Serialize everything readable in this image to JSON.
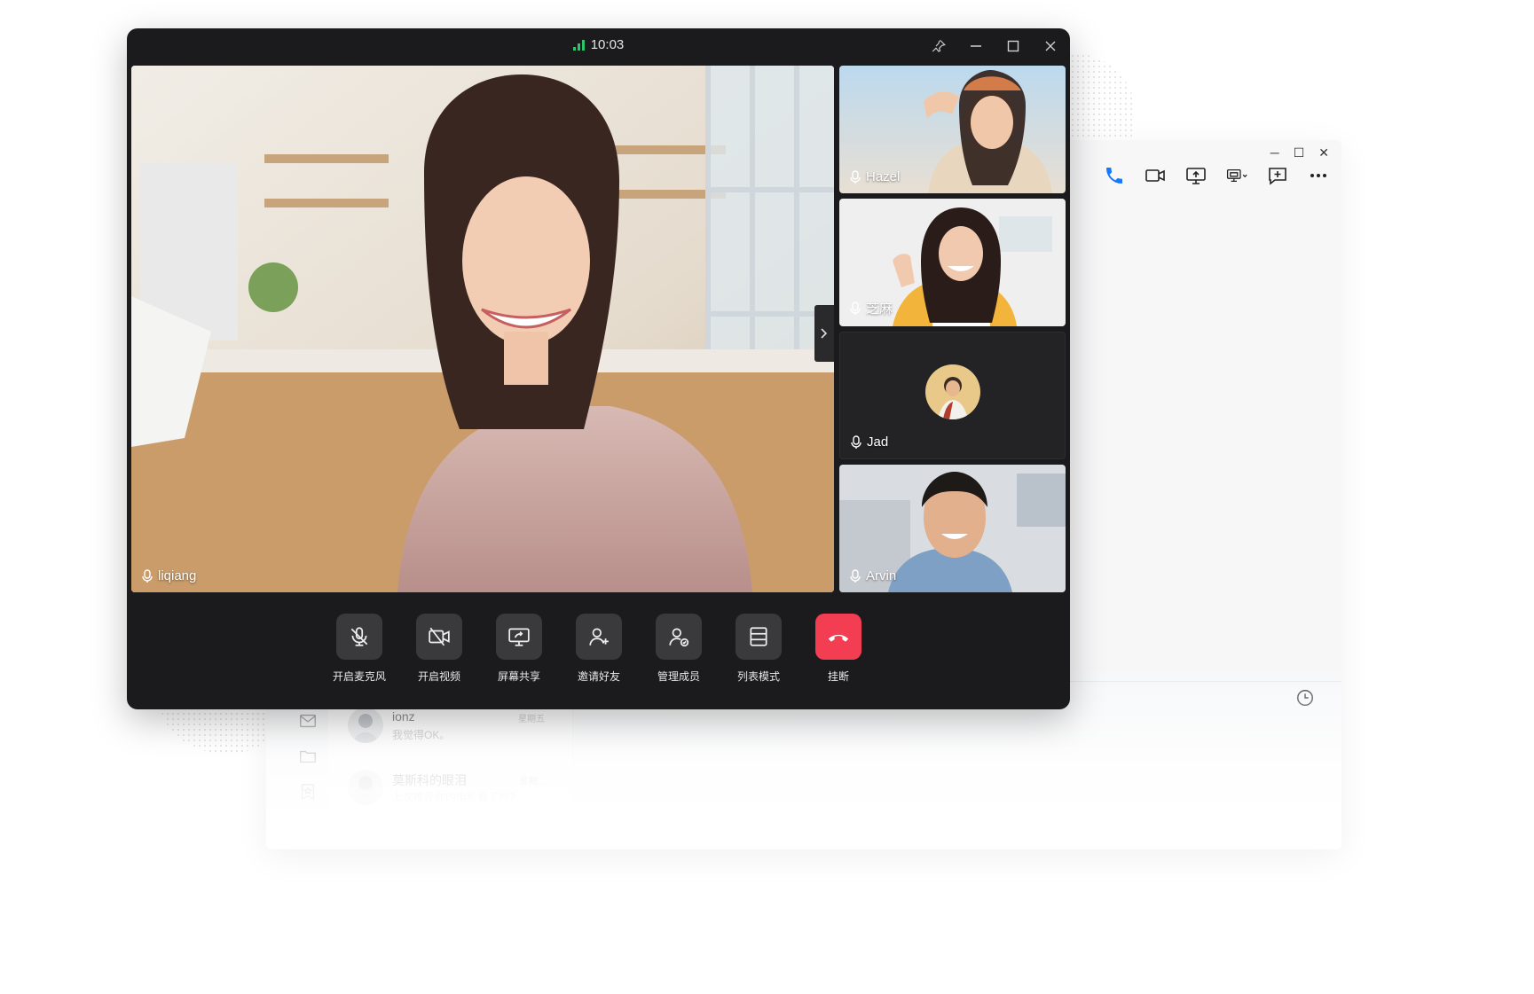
{
  "call_window": {
    "time": "10:03",
    "main_participant": {
      "name": "liqiang"
    },
    "participants": [
      {
        "name": "Hazel"
      },
      {
        "name": "芝麻"
      },
      {
        "name": "Jad"
      },
      {
        "name": "Arvin"
      }
    ],
    "controls": [
      {
        "label": "开启麦克风",
        "icon": "mic-off-icon"
      },
      {
        "label": "开启视频",
        "icon": "video-off-icon"
      },
      {
        "label": "屏幕共享",
        "icon": "screen-share-icon"
      },
      {
        "label": "邀请好友",
        "icon": "add-user-icon"
      },
      {
        "label": "管理成员",
        "icon": "manage-members-icon"
      },
      {
        "label": "列表模式",
        "icon": "list-mode-icon"
      },
      {
        "label": "挂断",
        "icon": "hang-up-icon"
      }
    ],
    "colors": {
      "hangup": "#f23d53",
      "signal": "#2bc56b",
      "background": "#1b1b1d"
    }
  },
  "chat_window": {
    "conversations": [
      {
        "name": "ionz",
        "preview": "我觉得OK。",
        "time": "星期五"
      },
      {
        "name": "莫斯科的眼泪",
        "preview": "上次推荐你的电影看了吗?",
        "time": "星期..."
      }
    ],
    "toolbar_icons": [
      "phone-icon",
      "video-call-icon",
      "screen-share-icon",
      "screen-select-icon",
      "add-chat-icon",
      "more-icon"
    ],
    "accent": "#1677ff"
  }
}
